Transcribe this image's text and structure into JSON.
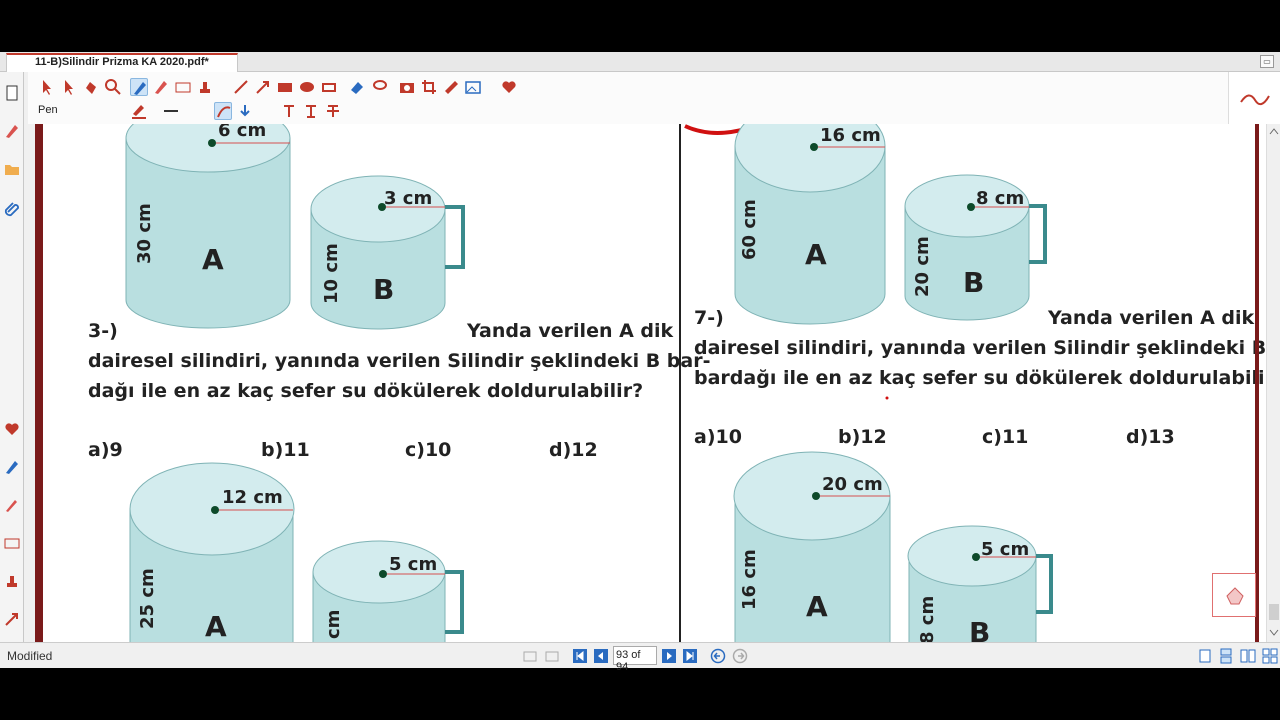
{
  "tab": {
    "title": "11-B)Silindir Prizma KA 2020.pdf*"
  },
  "toolbar": {
    "pen_label": "Pen"
  },
  "status": {
    "text": "Modified",
    "page_indicator": "93 of 94"
  },
  "left_page": {
    "top_cyl_a": {
      "radius": "6 cm",
      "height": "30 cm",
      "label": "A"
    },
    "top_cyl_b": {
      "radius": "3 cm",
      "height": "10 cm",
      "label": "B"
    },
    "question_num": "3-)",
    "question_line1": "Yanda verilen A dik",
    "question_line2": "dairesel silindiri, yanında verilen Silindir şeklindeki B bar-",
    "question_line3": "dağı ile en az kaç sefer su dökülerek doldurulabilir?",
    "answers": [
      "a)9",
      "b)11",
      "c)10",
      "d)12"
    ],
    "bottom_cyl_a": {
      "radius": "12 cm",
      "height": "25 cm",
      "label": "A"
    },
    "bottom_cyl_b": {
      "radius": "5 cm",
      "height": "cm"
    }
  },
  "right_page": {
    "top_cyl_a": {
      "radius": "16 cm",
      "height": "60 cm",
      "label": "A"
    },
    "top_cyl_b": {
      "radius": "8 cm",
      "height": "20 cm",
      "label": "B"
    },
    "question_num": "7-)",
    "question_line1": "Yanda verilen A dik",
    "question_line2": "dairesel silindiri, yanında verilen Silindir şeklindeki B",
    "question_line3": "bardağı ile en az kaç sefer su dökülerek doldurulabilir?",
    "answers": [
      "a)10",
      "b)12",
      "c)11",
      "d)13"
    ],
    "bottom_cyl_a": {
      "radius": "20 cm",
      "height": "16 cm",
      "label": "A"
    },
    "bottom_cyl_b": {
      "radius": "5 cm",
      "height": "8 cm",
      "label": "B"
    }
  },
  "colors": {
    "cylinder_fill": "#b9dfe0",
    "cylinder_top": "#d3ecee",
    "handle": "#3a8a8c",
    "accent_red": "#c0392b"
  }
}
